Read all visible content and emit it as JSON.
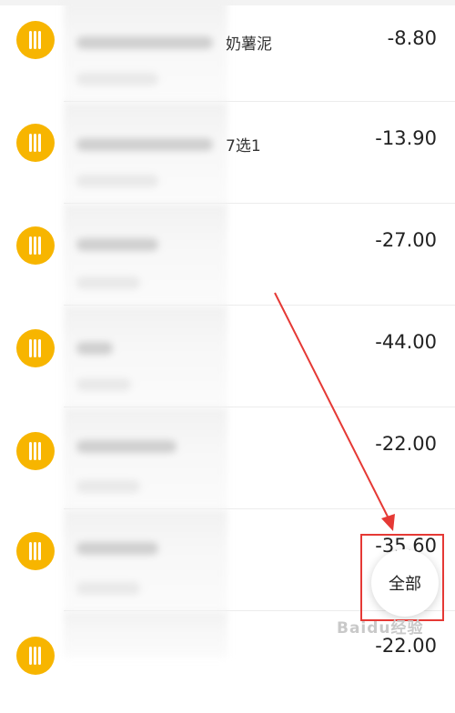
{
  "transactions": [
    {
      "merchant": "奶薯泥",
      "amount": "-8.80",
      "icon": "utensils-icon"
    },
    {
      "merchant": "7选1",
      "amount": "-13.90",
      "icon": "utensils-icon"
    },
    {
      "merchant": "",
      "amount": "-27.00",
      "icon": "utensils-icon"
    },
    {
      "merchant": "",
      "amount": "-44.00",
      "icon": "utensils-icon"
    },
    {
      "merchant": "",
      "amount": "-22.00",
      "icon": "utensils-icon"
    },
    {
      "merchant": "",
      "amount": "-35.60",
      "icon": "utensils-icon"
    },
    {
      "merchant": "",
      "amount": "-22.00",
      "icon": "utensils-icon"
    }
  ],
  "fab": {
    "label": "全部"
  },
  "watermark": "Baidu经验",
  "colors": {
    "icon_bg": "#f7b500",
    "annotation": "#e53935"
  }
}
